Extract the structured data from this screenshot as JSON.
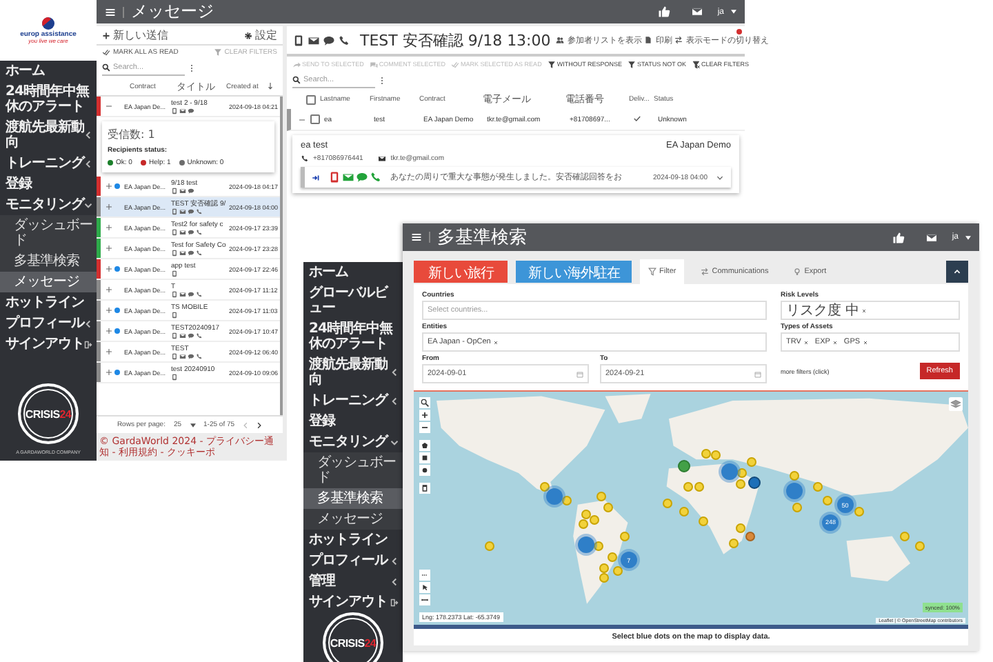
{
  "back_window": {
    "sidebar": {
      "logo": {
        "brand": "europ assistance",
        "tagline": "you live we care"
      },
      "nav": [
        {
          "label": "ホーム",
          "kind": "link",
          "selected": false
        },
        {
          "label": "24時間年中無休のアラート",
          "kind": "link",
          "selected": false
        },
        {
          "label": "渡航先最新動向",
          "kind": "group",
          "expanded": false
        },
        {
          "label": "トレーニング",
          "kind": "group",
          "expanded": false
        },
        {
          "label": "登録",
          "kind": "link",
          "selected": false
        },
        {
          "label": "モニタリング",
          "kind": "group",
          "expanded": true,
          "children": [
            {
              "label": "ダッシュボード",
              "selected": false
            },
            {
              "label": "多基準検索",
              "selected": false
            },
            {
              "label": "メッセージ",
              "selected": true
            }
          ]
        },
        {
          "label": "ホットライン",
          "kind": "link",
          "selected": false
        },
        {
          "label": "プロフィール",
          "kind": "group",
          "expanded": false
        },
        {
          "label": "サインアウト",
          "kind": "signout",
          "selected": false
        }
      ],
      "crisis_logo": {
        "word": "CRISIS",
        "number": "24",
        "company": "A GARDAWORLD COMPANY"
      }
    },
    "header": {
      "title": "メッセージ",
      "language": "ja"
    },
    "list_pane": {
      "new_label": "新しい送信",
      "settings_label": "設定",
      "mark_all": "MARK ALL AS READ",
      "clear_filters": "CLEAR FILTERS",
      "search_placeholder": "Search...",
      "columns": [
        "Contract",
        "タイトル",
        "Created at"
      ],
      "rows": [
        {
          "contract": "EA Japan De...",
          "title": "test 2 - 9/18",
          "created": "2024-09-18 04:21",
          "color": "#d32f2f",
          "unread": false,
          "expanded": true,
          "selected": false,
          "channels": [
            {
              "kind": "mobile"
            },
            {
              "kind": "mail"
            },
            {
              "kind": "chat"
            }
          ],
          "summary": {
            "recipients": "受信数: 1",
            "status_label": "Recipients status:",
            "statuses": [
              {
                "label": "Ok: 0",
                "color": "#1b7f2a"
              },
              {
                "label": "Help: 1",
                "color": "#c62828"
              },
              {
                "label": "Unknown: 0",
                "color": "#6d6d6d"
              }
            ]
          }
        },
        {
          "contract": "EA Japan De...",
          "title": "9/18 test",
          "created": "2024-09-18 04:17",
          "color": "#d32f2f",
          "unread": true,
          "expanded": false,
          "selected": false,
          "channels": [
            {
              "kind": "mobile"
            },
            {
              "kind": "mail"
            },
            {
              "kind": "chat"
            }
          ]
        },
        {
          "contract": "EA Japan De...",
          "title": "TEST 安否確認 9/",
          "created": "2024-09-18 04:00",
          "color": "#8a8a8a",
          "unread": false,
          "expanded": false,
          "selected": true,
          "channels": [
            {
              "kind": "mobile"
            },
            {
              "kind": "mail"
            },
            {
              "kind": "chat"
            },
            {
              "kind": "phone"
            }
          ]
        },
        {
          "contract": "EA Japan De...",
          "title": "Test2 for safety c",
          "created": "2024-09-17 23:39",
          "color": "#2eaa4a",
          "unread": false,
          "expanded": false,
          "selected": false,
          "channels": [
            {
              "kind": "mobile"
            },
            {
              "kind": "mail"
            },
            {
              "kind": "chat"
            },
            {
              "kind": "phone"
            }
          ]
        },
        {
          "contract": "EA Japan De...",
          "title": "Test for Safety Co",
          "created": "2024-09-17 23:28",
          "color": "#2eaa4a",
          "unread": false,
          "expanded": false,
          "selected": false,
          "channels": [
            {
              "kind": "mobile"
            },
            {
              "kind": "mail"
            },
            {
              "kind": "chat"
            },
            {
              "kind": "phone"
            }
          ]
        },
        {
          "contract": "EA Japan De...",
          "title": "app test",
          "created": "2024-09-17 22:46",
          "color": "#d32f2f",
          "unread": true,
          "expanded": false,
          "selected": false,
          "channels": [
            {
              "kind": "mobile"
            }
          ]
        },
        {
          "contract": "EA Japan De...",
          "title": "T",
          "created": "2024-09-17 11:12",
          "color": "#8a8a8a",
          "unread": false,
          "expanded": false,
          "selected": false,
          "channels": [
            {
              "kind": "mobile"
            },
            {
              "kind": "mail"
            },
            {
              "kind": "chat"
            },
            {
              "kind": "phone"
            }
          ]
        },
        {
          "contract": "EA Japan De...",
          "title": "TS MOBILE",
          "created": "2024-09-17 11:03",
          "color": "#8a8a8a",
          "unread": true,
          "expanded": false,
          "selected": false,
          "channels": [
            {
              "kind": "mobile"
            }
          ]
        },
        {
          "contract": "EA Japan De...",
          "title": "TEST20240917",
          "created": "2024-09-17 10:47",
          "color": "#8a8a8a",
          "unread": true,
          "expanded": false,
          "selected": false,
          "channels": [
            {
              "kind": "mobile"
            },
            {
              "kind": "mail"
            },
            {
              "kind": "chat"
            },
            {
              "kind": "phone"
            }
          ]
        },
        {
          "contract": "EA Japan De...",
          "title": "TEST",
          "created": "2024-09-12 06:40",
          "color": "#8a8a8a",
          "unread": false,
          "expanded": false,
          "selected": false,
          "channels": [
            {
              "kind": "mobile"
            },
            {
              "kind": "mail"
            },
            {
              "kind": "chat"
            },
            {
              "kind": "phone"
            }
          ]
        },
        {
          "contract": "EA Japan De...",
          "title": "test 20240910",
          "created": "2024-09-10 09:06",
          "color": "#8a8a8a",
          "unread": true,
          "expanded": false,
          "selected": false,
          "channels": [
            {
              "kind": "mobile"
            }
          ]
        }
      ],
      "pagination": {
        "rows_per_page_label": "Rows per page:",
        "rows_per_page": "25",
        "range": "1-25 of 75"
      }
    },
    "detail_pane": {
      "channels": [
        {
          "kind": "mobile"
        },
        {
          "kind": "mail"
        },
        {
          "kind": "chat"
        },
        {
          "kind": "phone"
        }
      ],
      "title": "TEST 安否確認 9/18 13:00",
      "actions": [
        {
          "label": "参加者リストを表示",
          "kind": "participants"
        },
        {
          "label": "印刷",
          "kind": "document"
        },
        {
          "label": "表示モードの切り替え",
          "kind": "switch"
        }
      ],
      "toolbar": [
        {
          "label": "SEND TO SELECTED",
          "kind": "send",
          "disabled": true
        },
        {
          "label": "COMMENT SELECTED",
          "kind": "comment",
          "disabled": true
        },
        {
          "label": "MARK SELECTED AS READ",
          "kind": "read",
          "disabled": true
        },
        {
          "label": "WITHOUT RESPONSE",
          "kind": "filter",
          "disabled": false
        },
        {
          "label": "STATUS NOT OK",
          "kind": "filter",
          "disabled": false
        },
        {
          "label": "CLEAR FILTERS",
          "kind": "clear",
          "disabled": false
        }
      ],
      "search_placeholder": "Search...",
      "header_checked": false,
      "columns": [
        "Lastname",
        "Firstname",
        "Contract",
        "電子メール",
        "電話番号",
        "Deliv...",
        "Status"
      ],
      "rows": [
        {
          "lastname": "ea",
          "firstname": "test",
          "contract": "EA Japan Demo",
          "email": "tkr.te@gmail.com",
          "phone": "+81708697...",
          "delivered": true,
          "status": "Unknown",
          "checked": false,
          "expanded": true
        }
      ],
      "card": {
        "name": "ea test",
        "company": "EA Japan Demo",
        "phone": "+817086976441",
        "email": "tkr.te@gmail.com",
        "channels": [
          {
            "kind": "mobile",
            "color": "#d32f2f"
          },
          {
            "kind": "mail",
            "color": "#22a33a"
          },
          {
            "kind": "chat",
            "color": "#22a33a"
          },
          {
            "kind": "phone",
            "color": "#22a33a"
          }
        ],
        "message": "あなたの周りで重大な事態が発生しました。安否確認回答をお",
        "time": "2024-09-18 04:00"
      }
    },
    "footer": "© GardaWorld 2024 - プライバシー通知 - 利用規約 - クッキーポ"
  },
  "front_window": {
    "sidebar": {
      "nav": [
        {
          "label": "ホーム",
          "kind": "link",
          "selected": false
        },
        {
          "label": "グローバルビュー",
          "kind": "link",
          "selected": false
        },
        {
          "label": "24時間年中無休のアラート",
          "kind": "link",
          "selected": false
        },
        {
          "label": "渡航先最新動向",
          "kind": "group",
          "expanded": false
        },
        {
          "label": "トレーニング",
          "kind": "group",
          "expanded": false
        },
        {
          "label": "登録",
          "kind": "link",
          "selected": false
        },
        {
          "label": "モニタリング",
          "kind": "group",
          "expanded": true,
          "children": [
            {
              "label": "ダッシュボード",
              "selected": false
            },
            {
              "label": "多基準検索",
              "selected": true
            },
            {
              "label": "メッセージ",
              "selected": false
            }
          ]
        },
        {
          "label": "ホットライン",
          "kind": "link",
          "selected": false
        },
        {
          "label": "プロフィール",
          "kind": "group",
          "expanded": false
        },
        {
          "label": "管理",
          "kind": "group",
          "expanded": false
        },
        {
          "label": "サインアウト",
          "kind": "signout",
          "selected": false
        }
      ],
      "crisis_logo": {
        "word": "CRISIS",
        "number": "24"
      }
    },
    "header": {
      "title": "多基準検索",
      "language": "ja"
    },
    "actions": [
      {
        "label": "新しい旅行",
        "kind": "trip"
      },
      {
        "label": "新しい海外駐在",
        "kind": "expat"
      }
    ],
    "tabs": [
      {
        "label": "Filter",
        "kind": "filter",
        "selected": true
      },
      {
        "label": "Communications",
        "kind": "communications",
        "selected": false
      },
      {
        "label": "Export",
        "kind": "export",
        "selected": false
      }
    ],
    "filters": {
      "countries": {
        "label": "Countries",
        "placeholder": "Select countries..."
      },
      "entities": {
        "label": "Entities",
        "tags": [
          "EA Japan - OpCen"
        ]
      },
      "from": {
        "label": "From",
        "value": "2024-09-01"
      },
      "to": {
        "label": "To",
        "value": "2024-09-21"
      },
      "risk_levels": {
        "label": "Risk Levels",
        "tags": [
          "リスク度 中"
        ]
      },
      "asset_types": {
        "label": "Types of Assets",
        "tags": [
          "TRV",
          "EXP",
          "GPS"
        ]
      },
      "more_filters": "more filters (click)",
      "refresh": "Refresh"
    },
    "map": {
      "clusters": [
        {
          "label": "50"
        },
        {
          "label": "248"
        },
        {
          "label": "7"
        }
      ],
      "coordinates": "Lng: 178.2373 Lat: -65.3749",
      "sync": "synced: 100%",
      "attribution": "Leaflet | © OpenStreetMap contributors"
    },
    "hint": "Select blue dots on the map to display data."
  }
}
